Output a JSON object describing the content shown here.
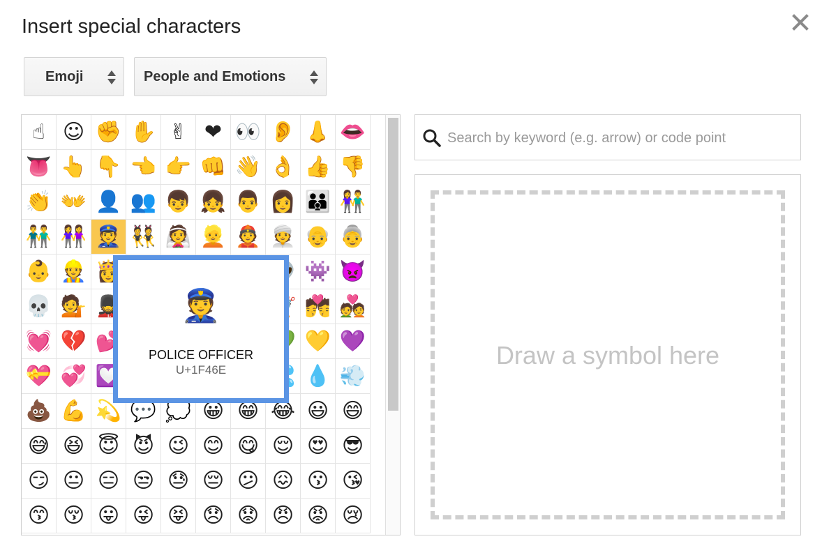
{
  "dialog": {
    "title": "Insert special characters",
    "close_icon": "close-icon"
  },
  "category_select": {
    "value": "Emoji"
  },
  "subcategory_select": {
    "value": "People and Emotions"
  },
  "search": {
    "placeholder": "Search by keyword (e.g. arrow) or code point",
    "value": "",
    "icon": "search-icon"
  },
  "draw": {
    "hint": "Draw a symbol here"
  },
  "preview": {
    "glyph": "👮",
    "name": "POLICE OFFICER",
    "code": "U+1F46E"
  },
  "grid": {
    "selected_index": 32,
    "cells": [
      "☝",
      "☺",
      "✊",
      "✋",
      "✌",
      "❤",
      "👀",
      "👂",
      "👃",
      "👄",
      "👅",
      "👆",
      "👇",
      "👈",
      "👉",
      "👊",
      "👋",
      "👌",
      "👍",
      "👎",
      "👏",
      "👐",
      "👤",
      "👥",
      "👦",
      "👧",
      "👨",
      "👩",
      "👪",
      "👫",
      "👬",
      "👭",
      "👮",
      "👯",
      "👰",
      "👱",
      "👲",
      "👳",
      "👴",
      "👵",
      "👶",
      "👷",
      "👸",
      "👹",
      "👺",
      "👻",
      "👼",
      "👽",
      "👾",
      "👿",
      "💀",
      "💁",
      "💂",
      "💃",
      "💄",
      "💅",
      "💆",
      "💇",
      "💏",
      "💑",
      "💓",
      "💔",
      "💕",
      "💖",
      "💗",
      "💘",
      "💙",
      "💚",
      "💛",
      "💜",
      "💝",
      "💞",
      "💟",
      "💢",
      "💣",
      "💤",
      "💥",
      "💦",
      "💧",
      "💨",
      "💩",
      "💪",
      "💫",
      "💬",
      "💭",
      "😀",
      "😁",
      "😂",
      "😃",
      "😄",
      "😅",
      "😆",
      "😇",
      "😈",
      "😉",
      "😊",
      "😋",
      "😌",
      "😍",
      "😎",
      "😏",
      "😐",
      "😑",
      "😒",
      "😓",
      "😔",
      "😕",
      "😖",
      "😗",
      "😘",
      "😙",
      "😚",
      "😛",
      "😜",
      "😝",
      "😞",
      "😟",
      "😠",
      "😡",
      "😢"
    ]
  },
  "colors": {
    "selection": "#f9c74f",
    "preview_border": "#5b94e4"
  }
}
